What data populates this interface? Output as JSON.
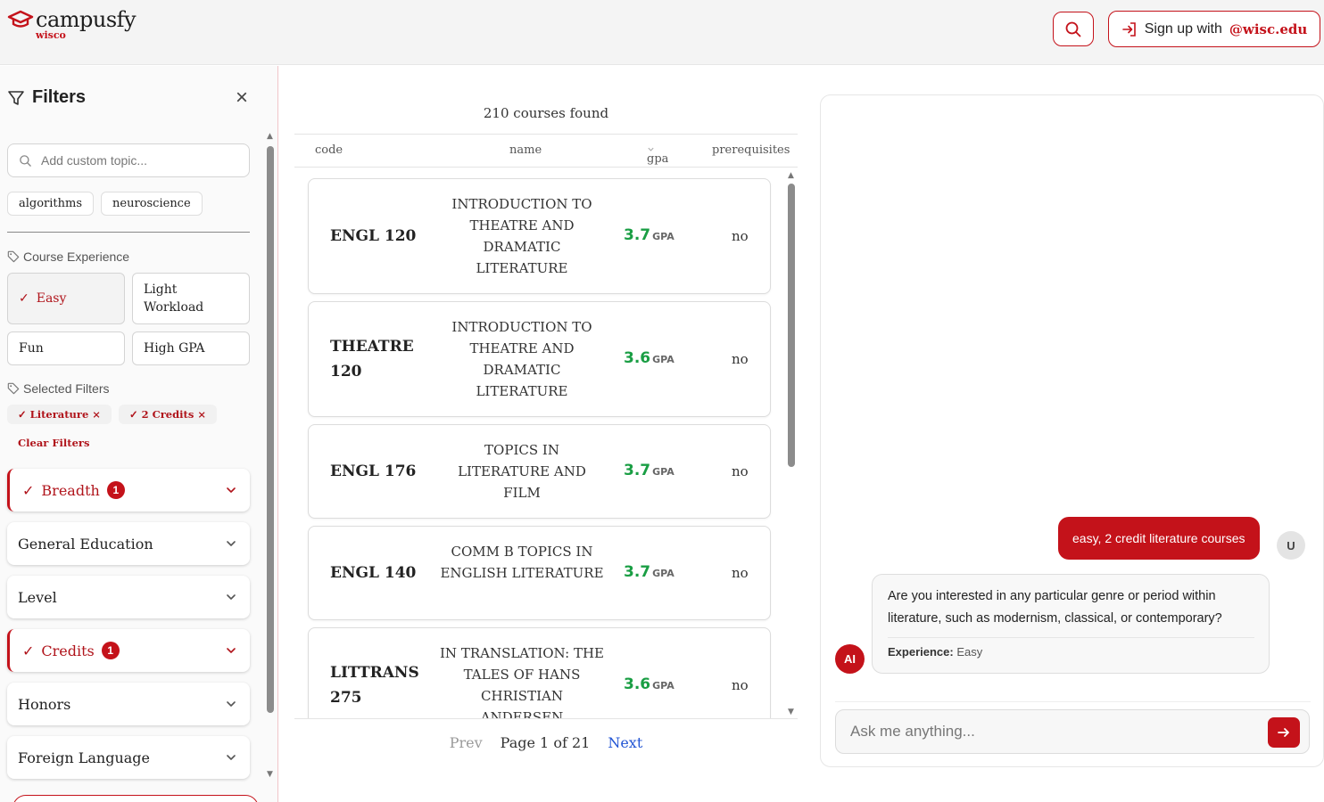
{
  "brand": {
    "name": "campusfy",
    "school": "wisco",
    "accent": "#c4121a"
  },
  "header": {
    "signup_prefix": "Sign up with",
    "signup_domain": "@wisc.edu",
    "search_icon": "search-icon",
    "login_icon": "login-arrow-icon"
  },
  "sidebar": {
    "title": "Filters",
    "close_glyph": "×",
    "topic_placeholder": "Add custom topic...",
    "topics": [
      "algorithms",
      "neuroscience"
    ],
    "experience_label": "Course Experience",
    "experience": [
      {
        "label": "Easy",
        "selected": true
      },
      {
        "label": "Light Workload",
        "selected": false
      },
      {
        "label": "Fun",
        "selected": false
      },
      {
        "label": "High GPA",
        "selected": false
      }
    ],
    "selected_label": "Selected Filters",
    "selected_filters": [
      "Literature",
      "2 Credits"
    ],
    "clear_label": "Clear Filters",
    "sections": [
      {
        "label": "Breadth",
        "active": true,
        "count": "1"
      },
      {
        "label": "General Education",
        "active": false,
        "count": ""
      },
      {
        "label": "Level",
        "active": false,
        "count": ""
      },
      {
        "label": "Credits",
        "active": true,
        "count": "1"
      },
      {
        "label": "Honors",
        "active": false,
        "count": ""
      },
      {
        "label": "Foreign Language",
        "active": false,
        "count": ""
      }
    ]
  },
  "results": {
    "found_label": "210 courses found",
    "columns": {
      "code": "code",
      "name": "name",
      "gpa": "gpa",
      "prereq": "prerequisites"
    },
    "gpa_unit": "GPA",
    "courses": [
      {
        "code": "ENGL 120",
        "name": "INTRODUCTION TO THEATRE AND DRAMATIC LITERATURE",
        "gpa": "3.7",
        "prereq": "no"
      },
      {
        "code": "THEATRE 120",
        "name": "INTRODUCTION TO THEATRE AND DRAMATIC LITERATURE",
        "gpa": "3.6",
        "prereq": "no"
      },
      {
        "code": "ENGL 176",
        "name": "TOPICS IN LITERATURE AND FILM",
        "gpa": "3.7",
        "prereq": "no"
      },
      {
        "code": "ENGL 140",
        "name": "COMM B TOPICS IN ENGLISH LITERATURE",
        "gpa": "3.7",
        "prereq": "no"
      },
      {
        "code": "LITTRANS 275",
        "name": "IN TRANSLATION: THE TALES OF HANS CHRISTIAN ANDERSEN",
        "gpa": "3.6",
        "prereq": "no"
      }
    ],
    "pager": {
      "prev": "Prev",
      "page": "Page 1 of 21",
      "next": "Next"
    }
  },
  "chat": {
    "user_message": "easy, 2 credit literature courses",
    "user_avatar": "U",
    "ai_avatar": "AI",
    "ai_message": "Are you interested in any particular genre or period within literature, such as modernism, classical, or contemporary?",
    "ai_meta_label": "Experience:",
    "ai_meta_value": "Easy",
    "input_placeholder": "Ask me anything..."
  }
}
